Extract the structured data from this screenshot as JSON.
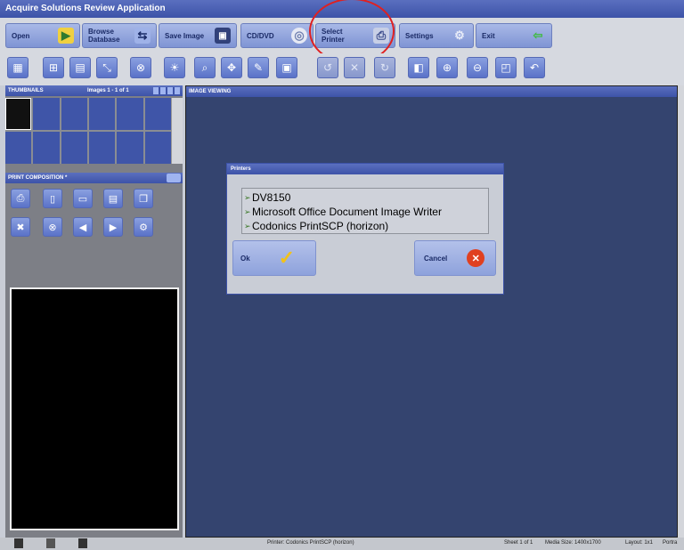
{
  "app": {
    "title": "Acquire Solutions Review Application"
  },
  "main_toolbar": {
    "open": "Open",
    "browse_database": "Browse Database",
    "save_image": "Save Image",
    "cd_dvd": "CD/DVD",
    "select_printer": "Select Printer",
    "settings": "Settings",
    "exit": "Exit"
  },
  "thumbnails": {
    "header": "THUMBNAILS",
    "images_count": "Images 1 - 1 of 1"
  },
  "print_composition": {
    "header": "PRINT COMPOSITION *"
  },
  "image_viewing": {
    "header": "IMAGE VIEWING"
  },
  "printer_dialog": {
    "title": "Printers",
    "printers": [
      "DV8150",
      "Microsoft Office Document Image Writer",
      "Codonics PrintSCP (horizon)"
    ],
    "ok_label": "Ok",
    "cancel_label": "Cancel"
  },
  "status_bar": {
    "printer": "Printer: Codonics PrintSCP (horizon)",
    "sheet": "Sheet 1 of 1",
    "media_size": "Media Size: 1400x1700",
    "layout": "Layout: 1x1",
    "orientation": "Portra"
  },
  "colors": {
    "accent": "#3d53a8",
    "viewer_bg": "#34446f",
    "highlight_circle": "#e02020"
  }
}
